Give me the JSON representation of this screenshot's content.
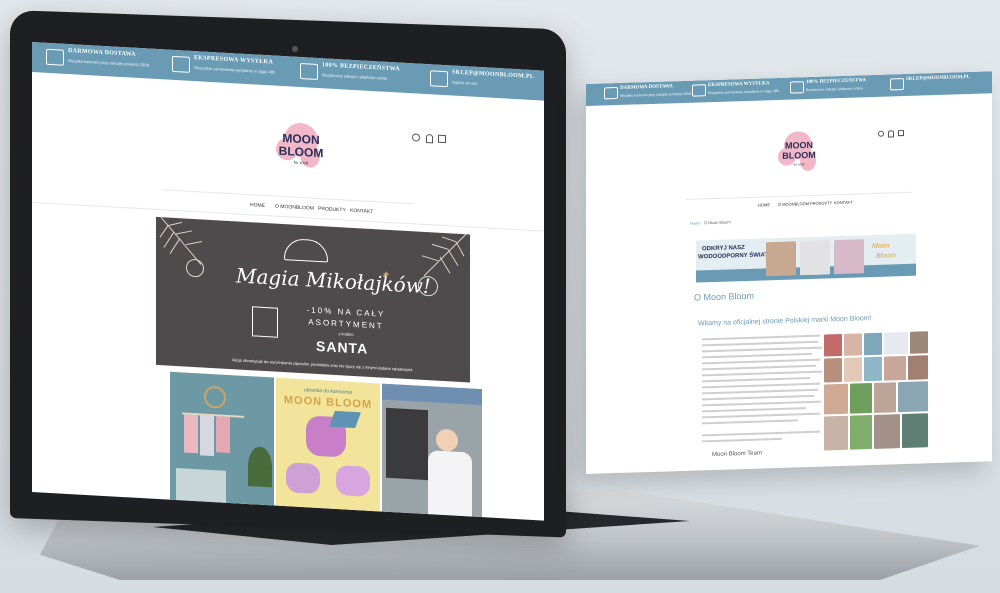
{
  "topbar": {
    "items": [
      {
        "icon": "truck-icon",
        "title": "DARMOWA DOSTAWA",
        "subtitle": "Wysyłka kurierem przy zakupie powyżej 200zł"
      },
      {
        "icon": "plane-icon",
        "title": "EKSPRESOWA WYSYŁKA",
        "subtitle": "Wszystkie zamówienia wysyłamy w ciągu 48h"
      },
      {
        "icon": "thumbs-up-icon",
        "title": "100% BEZPIECZEŃSTWA",
        "subtitle": "Bezpieczne zakupy i płatności online"
      },
      {
        "icon": "mail-icon",
        "title": "SKLEP@MOONBLOOM.PL",
        "subtitle": "Napisz do nas"
      }
    ]
  },
  "logo": {
    "line1": "MOON",
    "line2": "BLOOM",
    "tag": "for a kid"
  },
  "nav": {
    "items": [
      "HOME",
      "O MOONBLOOM",
      "PRODUKTY",
      "KONTAKT"
    ]
  },
  "banner": {
    "script_title": "Magia Mikołajków!",
    "discount_line1": "-10% NA CAŁY",
    "discount_line2": "ASORTYMENT",
    "code_label": "z kodem",
    "code": "SANTA",
    "note": "Akcja obowiązuje do wyczerpania zapasów, produktów oraz nie łączy się z innymi kodami rabatowymi."
  },
  "tiles": {
    "middle_caption": "ubranka do karmienia",
    "middle_title": "MOON BLOOM"
  },
  "page2": {
    "breadcrumb_home": "Home",
    "breadcrumb_current": "O Moon Bloom",
    "promo_left_line1": "ODKRYJ NASZ",
    "promo_left_line2": "WODOODPORNY ŚWIAT",
    "promo_right_line1": "Moon",
    "promo_right_line2": "Bloom",
    "heading": "O Moon Bloom",
    "subheading": "Witamy na oficjalnej stronie Polskiej marki Moon Bloom!",
    "signature": "Moon Bloom Team"
  },
  "colors": {
    "topbar": "#6a9bb5",
    "logo_pink": "#f2b8c8",
    "logo_navy": "#27305a",
    "banner_bg": "#4f4b4d"
  }
}
